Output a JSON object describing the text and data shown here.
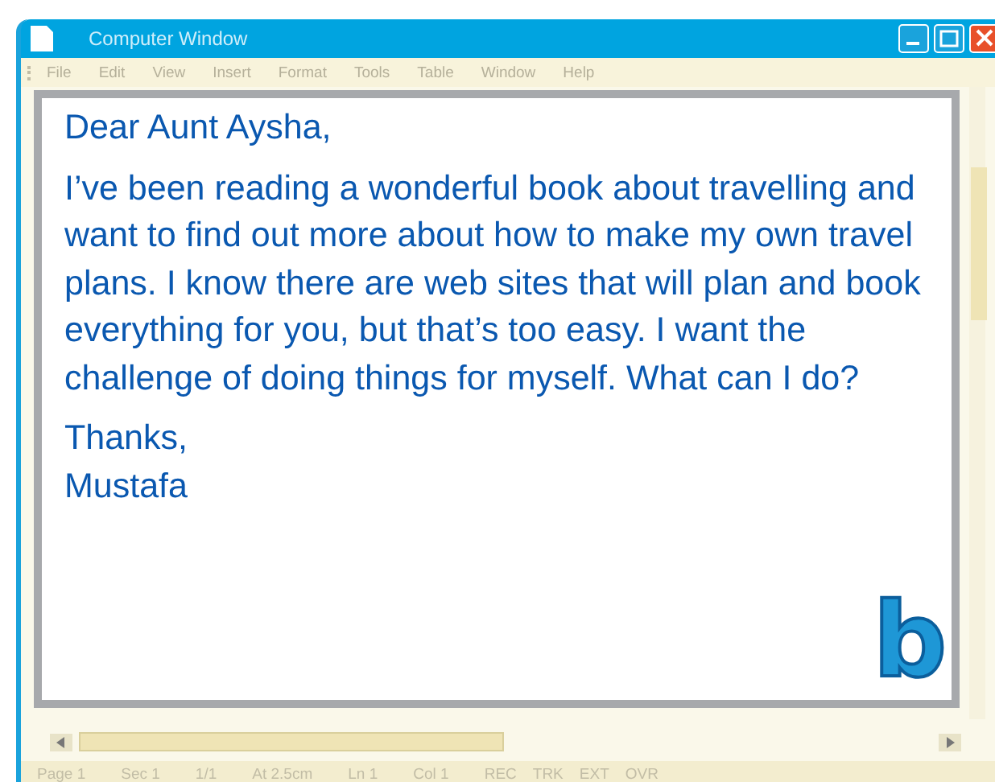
{
  "window": {
    "title": "Computer Window"
  },
  "menu": [
    "File",
    "Edit",
    "View",
    "Insert",
    "Format",
    "Tools",
    "Table",
    "Window",
    "Help"
  ],
  "letter": {
    "greeting": "Dear Aunt Aysha,",
    "body": "I’ve been reading a wonderful book about travelling and want to find out more about how to make my own travel plans. I know there are web sites that will plan and book everything for you, but that’s too easy. I want the challenge of doing things for myself. What can I do?",
    "closing": "Thanks,",
    "signature": "Mustafa"
  },
  "logo": "b",
  "status_bar": [
    "Page 1",
    "Sec 1",
    "1/1",
    "At 2.5cm",
    "Ln 1",
    "Col 1",
    "REC",
    "TRK",
    "EXT",
    "OVR"
  ]
}
